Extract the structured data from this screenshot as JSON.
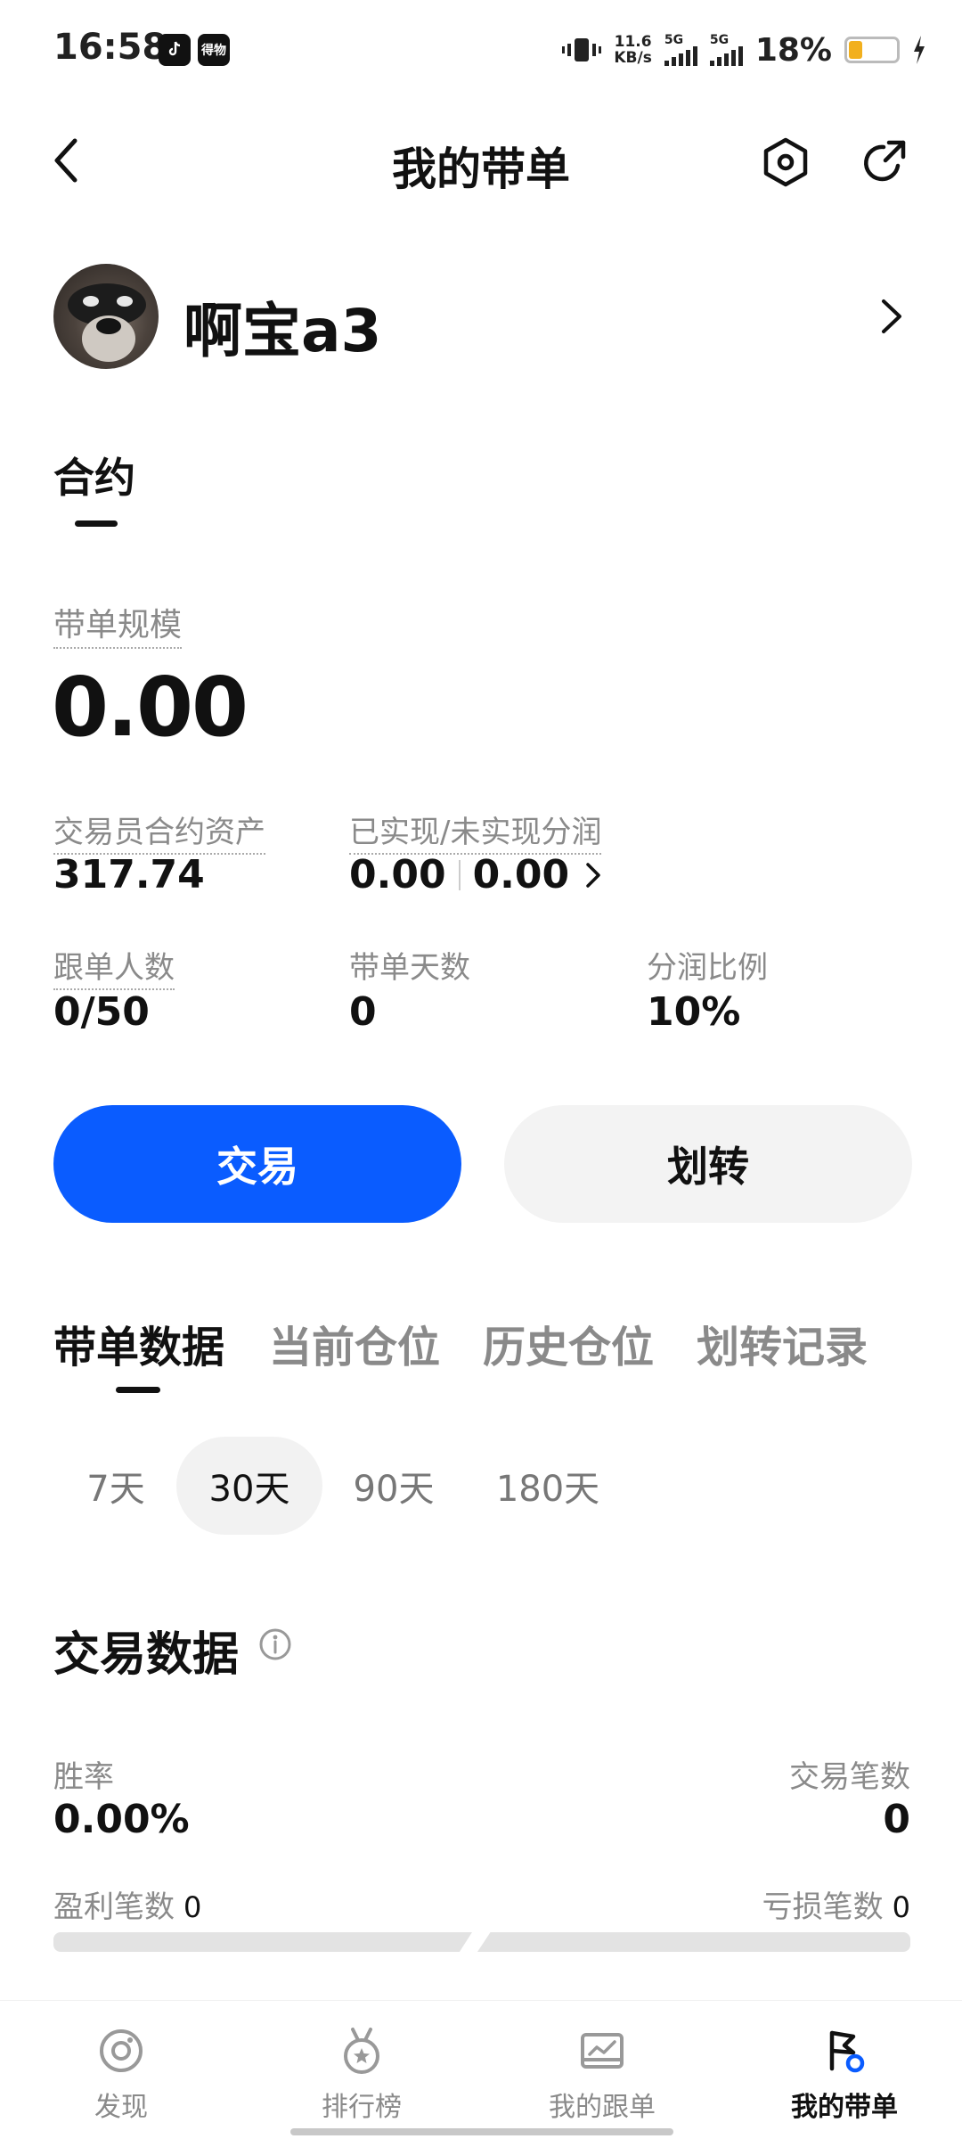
{
  "status_bar": {
    "time": "16:58",
    "app_icon_2": "得物",
    "net_speed_top": "11.6",
    "net_speed_bottom": "KB/s",
    "sim1_label": "5G",
    "sim2_label": "5G",
    "battery": "18%",
    "battery_level": 0.18,
    "battery_color": "#f2b01e"
  },
  "header": {
    "title": "我的带单",
    "back_icon": "chevron-left-icon",
    "settings_icon": "hexagon-settings-icon",
    "share_icon": "share-icon"
  },
  "profile": {
    "username": "啊宝a3"
  },
  "contract_tab": {
    "label": "合约"
  },
  "scale": {
    "label": "带单规模",
    "value": "0.00"
  },
  "stats": {
    "assets_label": "交易员合约资产",
    "assets_value": "317.74",
    "pnl_label": "已实现/未实现分润",
    "realized": "0.00",
    "unrealized": "0.00",
    "followers_label": "跟单人数",
    "followers_value": "0/50",
    "days_label": "带单天数",
    "days_value": "0",
    "share_label": "分润比例",
    "share_value": "10%"
  },
  "actions": {
    "trade": "交易",
    "transfer": "划转",
    "accent": "#0a5cff"
  },
  "main_tabs": [
    "带单数据",
    "当前仓位",
    "历史仓位",
    "划转记录"
  ],
  "periods": [
    "7天",
    "30天",
    "90天",
    "180天"
  ],
  "active_period": "30天",
  "trade_data": {
    "title": "交易数据",
    "win_rate_label": "胜率",
    "win_rate_value": "0.00%",
    "trades_label": "交易笔数",
    "trades_value": "0",
    "profit_label": "盈利笔数",
    "profit_value": "0",
    "loss_label": "亏损笔数",
    "loss_value": "0"
  },
  "bottom_nav": [
    {
      "label": "发现",
      "icon": "discover-icon"
    },
    {
      "label": "排行榜",
      "icon": "medal-icon"
    },
    {
      "label": "我的跟单",
      "icon": "chart-tray-icon"
    },
    {
      "label": "我的带单",
      "icon": "flag-icon"
    }
  ]
}
